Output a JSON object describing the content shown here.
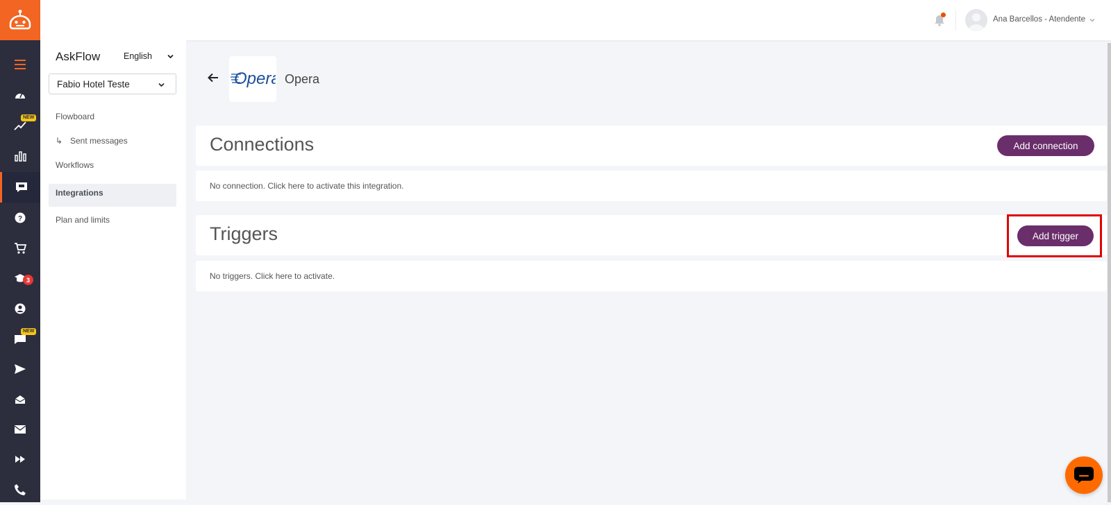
{
  "brand": {
    "accent": "#f26522",
    "rail_bg": "#2c2e3e",
    "button": "#6a2e6b",
    "highlight": "#e00000"
  },
  "rail": {
    "items": [
      {
        "icon": "menu-icon"
      },
      {
        "icon": "dashboard-icon"
      },
      {
        "icon": "trending-icon",
        "badge": "NEW"
      },
      {
        "icon": "bar-chart-icon"
      },
      {
        "icon": "chatbot-icon",
        "active": true
      },
      {
        "icon": "help-icon"
      },
      {
        "icon": "cart-icon"
      },
      {
        "icon": "graduation-icon",
        "count": "3"
      },
      {
        "icon": "account-icon"
      },
      {
        "icon": "chat-icon",
        "badge": "NEW"
      },
      {
        "icon": "send-icon"
      },
      {
        "icon": "inbox-icon"
      },
      {
        "icon": "mail-icon"
      },
      {
        "icon": "fast-forward-icon"
      },
      {
        "icon": "phone-icon"
      }
    ]
  },
  "topbar": {
    "user": "Ana Barcellos - Atendente"
  },
  "panel": {
    "title": "AskFlow",
    "language": "English",
    "hotel": "Fabio Hotel Teste",
    "nav": {
      "flowboard": "Flowboard",
      "sent_messages_arrow": "↳",
      "sent_messages": "Sent messages",
      "workflows": "Workflows",
      "integrations": "Integrations",
      "plan": "Plan and limits"
    }
  },
  "main": {
    "integration_name": "Opera",
    "logo_text": "Opera",
    "connections": {
      "title": "Connections",
      "button": "Add connection",
      "empty": "No connection. Click here to activate this integration."
    },
    "triggers": {
      "title": "Triggers",
      "button": "Add trigger",
      "empty": "No triggers. Click here to activate."
    }
  }
}
